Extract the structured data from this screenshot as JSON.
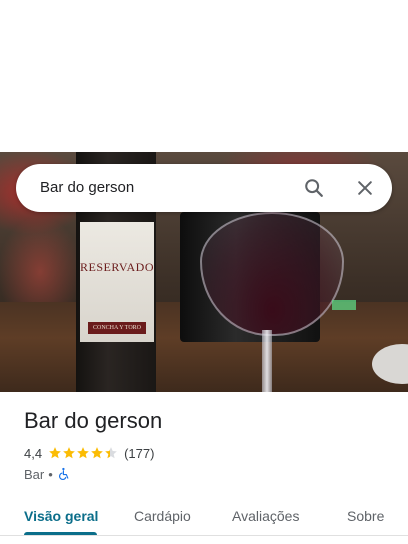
{
  "search": {
    "query": "Bar do gerson"
  },
  "photo": {
    "bottle_brand": "RESERVADO",
    "bottle_maker": "CONCHA Y TORO"
  },
  "place": {
    "name": "Bar do gerson",
    "rating": "4,4",
    "rating_value": 4.4,
    "review_count": "(177)",
    "category": "Bar",
    "separator": "•"
  },
  "tabs": [
    {
      "label": "Visão geral",
      "active": true
    },
    {
      "label": "Cardápio",
      "active": false
    },
    {
      "label": "Avaliações",
      "active": false
    },
    {
      "label": "Sobre",
      "active": false
    }
  ],
  "icons": {
    "search": "search-icon",
    "close": "close-icon",
    "accessible": "wheelchair-icon",
    "star": "star-icon"
  },
  "colors": {
    "accent": "#0b6e8a",
    "star": "#fbbc04",
    "accessible": "#1a73e8"
  }
}
